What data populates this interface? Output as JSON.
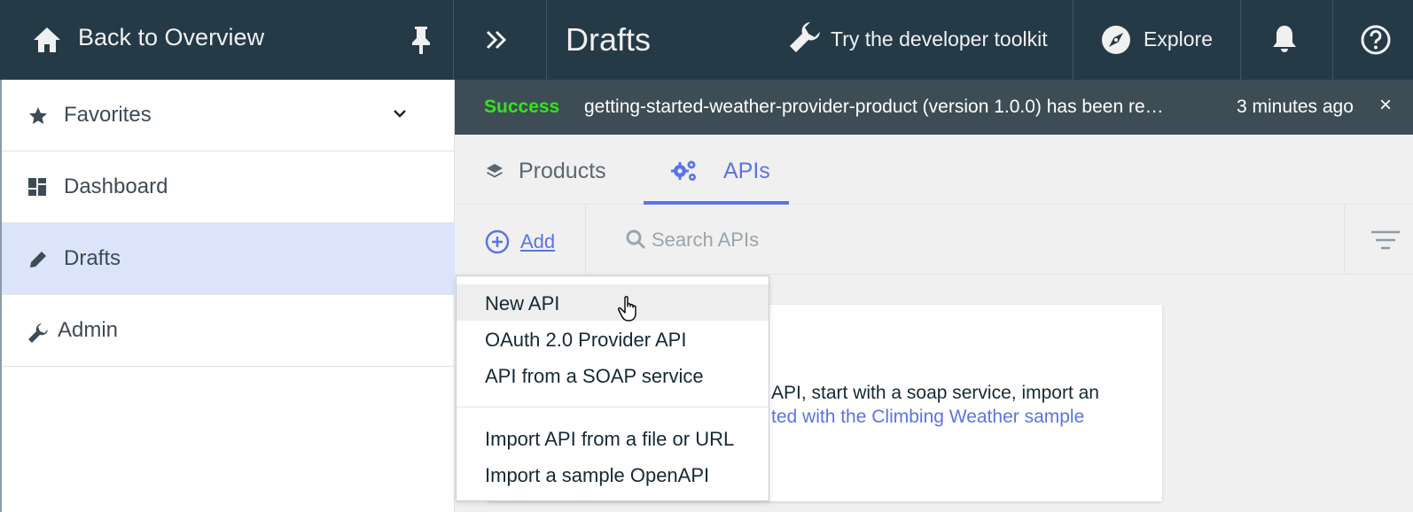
{
  "header": {
    "back_label": "Back to Overview",
    "page_title": "Drafts",
    "toolkit_label": "Try the developer toolkit",
    "explore_label": "Explore"
  },
  "sidebar": {
    "items": [
      {
        "label": "Favorites",
        "icon": "star-icon"
      },
      {
        "label": "Dashboard",
        "icon": "dashboard-icon"
      },
      {
        "label": "Drafts",
        "icon": "pencil-icon",
        "active": true
      },
      {
        "label": "Admin",
        "icon": "wrench-icon"
      }
    ]
  },
  "notification": {
    "status": "Success",
    "message": "getting-started-weather-provider-product (version 1.0.0) has been re…",
    "time": "3 minutes ago",
    "close": "×"
  },
  "tabs": [
    {
      "label": "Products",
      "icon": "layers-icon"
    },
    {
      "label": "APIs",
      "icon": "gears-icon",
      "selected": true
    }
  ],
  "toolbar": {
    "add_label": "Add",
    "search_placeholder": "Search APIs"
  },
  "empty_state": {
    "line1": "API, start with a soap service, import an",
    "line2": "ted with the Climbing Weather sample"
  },
  "add_menu": {
    "items": [
      "New API",
      "OAuth 2.0 Provider API",
      "API from a SOAP service",
      "Import API from a file or URL",
      "Import a sample OpenAPI"
    ]
  },
  "colors": {
    "header_bg": "#253a47",
    "accent": "#5a74e6",
    "success": "#32e61b",
    "active_nav_bg": "#dce4fb",
    "notice_bg": "#3e4d55"
  }
}
